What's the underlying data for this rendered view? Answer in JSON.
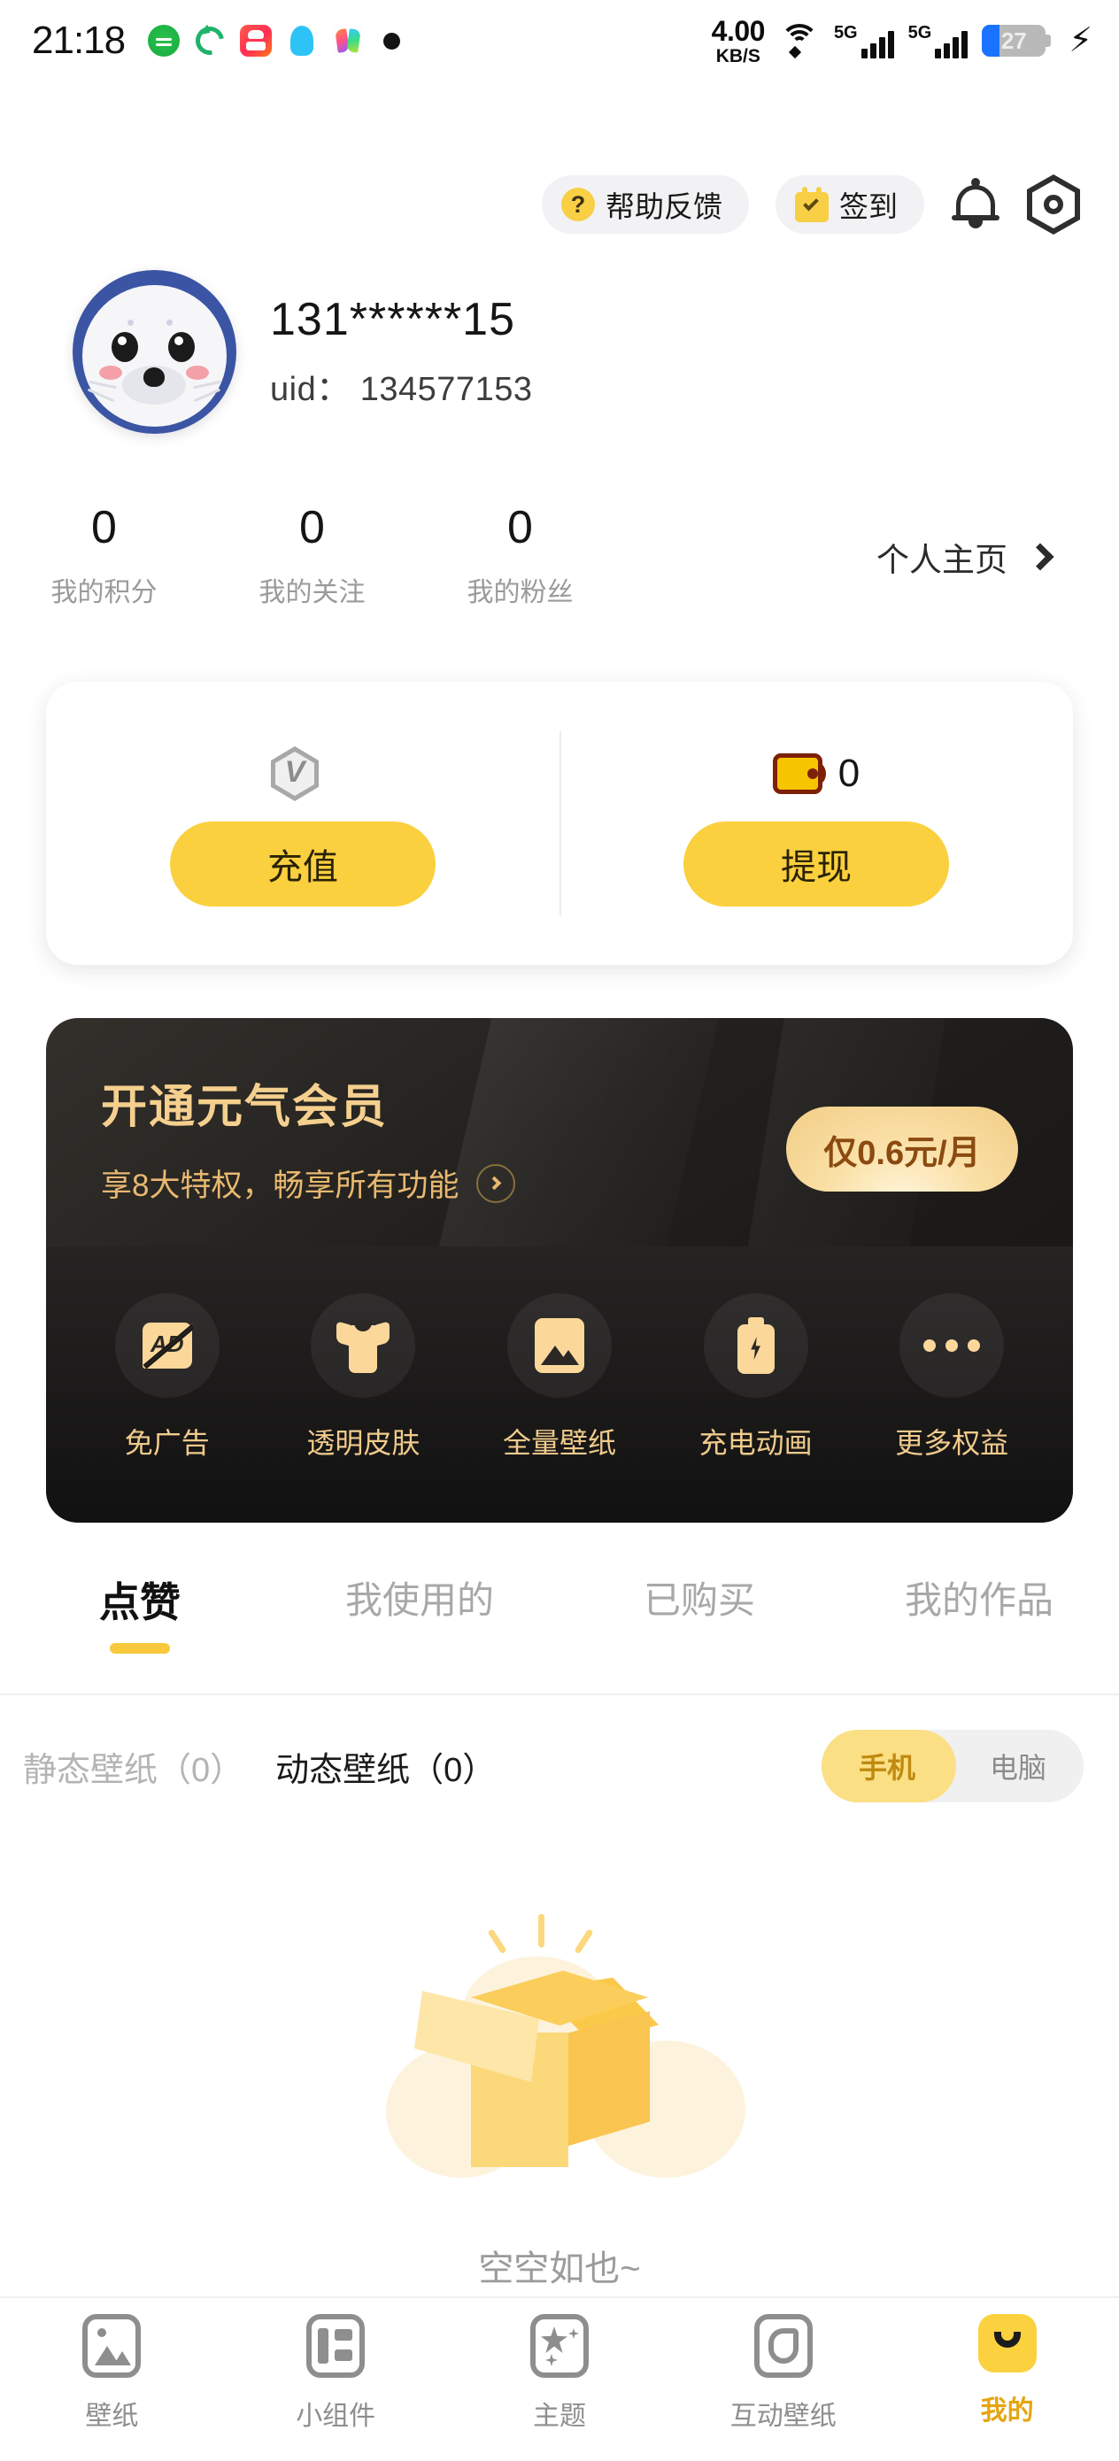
{
  "status_bar": {
    "time": "21:18",
    "app_icons": [
      "wechat-icon",
      "sync-icon",
      "kuaishou-icon",
      "qq-icon",
      "notes-icon"
    ],
    "network_speed_value": "4.00",
    "network_speed_unit": "KB/S",
    "wifi": "wifi-icon",
    "sim1_label": "5G",
    "sim2_label": "5G",
    "battery_percent": "27",
    "battery_fill_color": "#1a73ff",
    "charging": "charging-bolt-icon"
  },
  "header": {
    "help_label": "帮助反馈",
    "checkin_label": "签到",
    "bell_icon": "bell-icon",
    "settings_icon": "settings-hexagon-icon"
  },
  "profile": {
    "avatar": "seal-avatar",
    "nickname": "131******15",
    "uid": "uid： 134577153"
  },
  "stats": [
    {
      "value": "0",
      "label": "我的积分"
    },
    {
      "value": "0",
      "label": "我的关注"
    },
    {
      "value": "0",
      "label": "我的粉丝"
    }
  ],
  "home_link": {
    "label": "个人主页",
    "icon": "chevron-right-icon"
  },
  "wallet": {
    "vip_icon": "vip-gem-icon",
    "vip_value": "",
    "recharge_label": "充值",
    "coin_icon": "wallet-icon",
    "coin_value": "0",
    "withdraw_label": "提现"
  },
  "vip_banner": {
    "title": "开通元气会员",
    "subtitle": "享8大特权，畅享所有功能",
    "arrow_icon": "chevron-right-circle-icon",
    "price_label": "仅0.6元/月",
    "perks": [
      {
        "icon": "no-ad-icon",
        "label": "免广告"
      },
      {
        "icon": "tshirt-icon",
        "label": "透明皮肤"
      },
      {
        "icon": "image-icon",
        "label": "全量壁纸"
      },
      {
        "icon": "battery-bolt-icon",
        "label": "充电动画"
      },
      {
        "icon": "ellipsis-icon",
        "label": "更多权益"
      }
    ]
  },
  "tabs": [
    {
      "label": "点赞",
      "active": true
    },
    {
      "label": "我使用的",
      "active": false
    },
    {
      "label": "已购买",
      "active": false
    },
    {
      "label": "我的作品",
      "active": false
    }
  ],
  "filters": {
    "items": [
      {
        "label": "静态壁纸（0）",
        "active": false
      },
      {
        "label": "动态壁纸（0）",
        "active": true
      }
    ],
    "segment": [
      {
        "label": "手机",
        "active": true
      },
      {
        "label": "电脑",
        "active": false
      }
    ]
  },
  "empty_state": {
    "illustration": "empty-box-icon",
    "text": "空空如也~"
  },
  "bottom_nav": [
    {
      "icon": "wallpaper-icon",
      "label": "壁纸",
      "active": false
    },
    {
      "icon": "widget-icon",
      "label": "小组件",
      "active": false
    },
    {
      "icon": "theme-magic-icon",
      "label": "主题",
      "active": false
    },
    {
      "icon": "interactive-wallpaper-icon",
      "label": "互动壁纸",
      "active": false
    },
    {
      "icon": "profile-smile-icon",
      "label": "我的",
      "active": true
    }
  ],
  "colors": {
    "accent_yellow": "#fbd03e",
    "vip_gold": "#f0cb8c",
    "battery_blue": "#1a73ff"
  }
}
